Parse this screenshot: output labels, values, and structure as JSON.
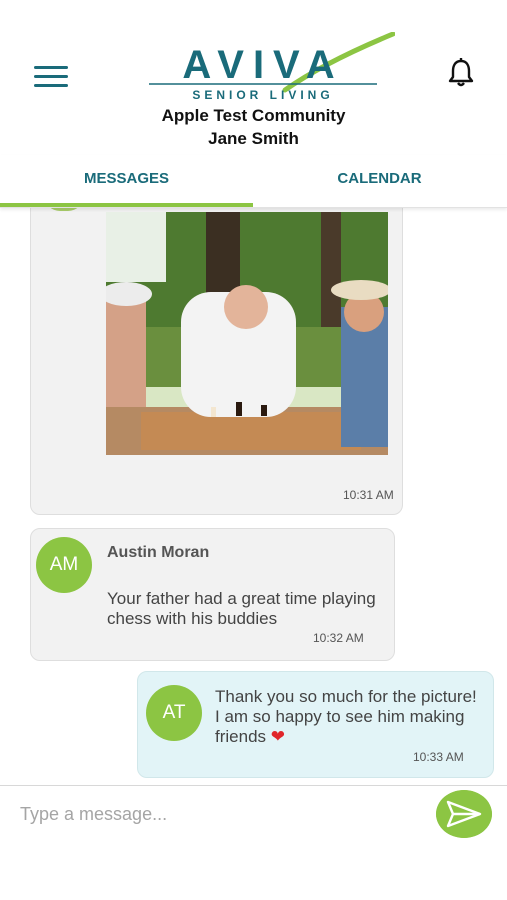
{
  "header": {
    "logo": {
      "wordmark": "AVIVA",
      "tagline": "SENIOR LIVING"
    },
    "community": "Apple Test Community",
    "user_name": "Jane Smith"
  },
  "tabs": [
    {
      "label": "MESSAGES",
      "active": true
    },
    {
      "label": "CALENDAR",
      "active": false
    }
  ],
  "messages": [
    {
      "type": "image",
      "direction": "incoming",
      "time": "10:31 AM"
    },
    {
      "type": "text",
      "direction": "incoming",
      "initials": "AM",
      "sender": "Austin Moran",
      "text": "Your father had a great time playing chess with his buddies",
      "time": "10:32 AM"
    },
    {
      "type": "text",
      "direction": "outgoing",
      "initials": "AT",
      "text": "Thank you so much for the picture! I am so happy to see him making friends",
      "emoji": "❤",
      "time": "10:33 AM"
    }
  ],
  "composer": {
    "placeholder": "Type a message...",
    "value": ""
  },
  "colors": {
    "brand_teal": "#1a6b7a",
    "accent_green": "#8cc543",
    "outgoing_bubble": "#e2f4f7",
    "incoming_bubble": "#f2f2f2"
  },
  "icons": {
    "menu": "hamburger-icon",
    "notifications": "bell-icon",
    "send": "send-icon"
  }
}
